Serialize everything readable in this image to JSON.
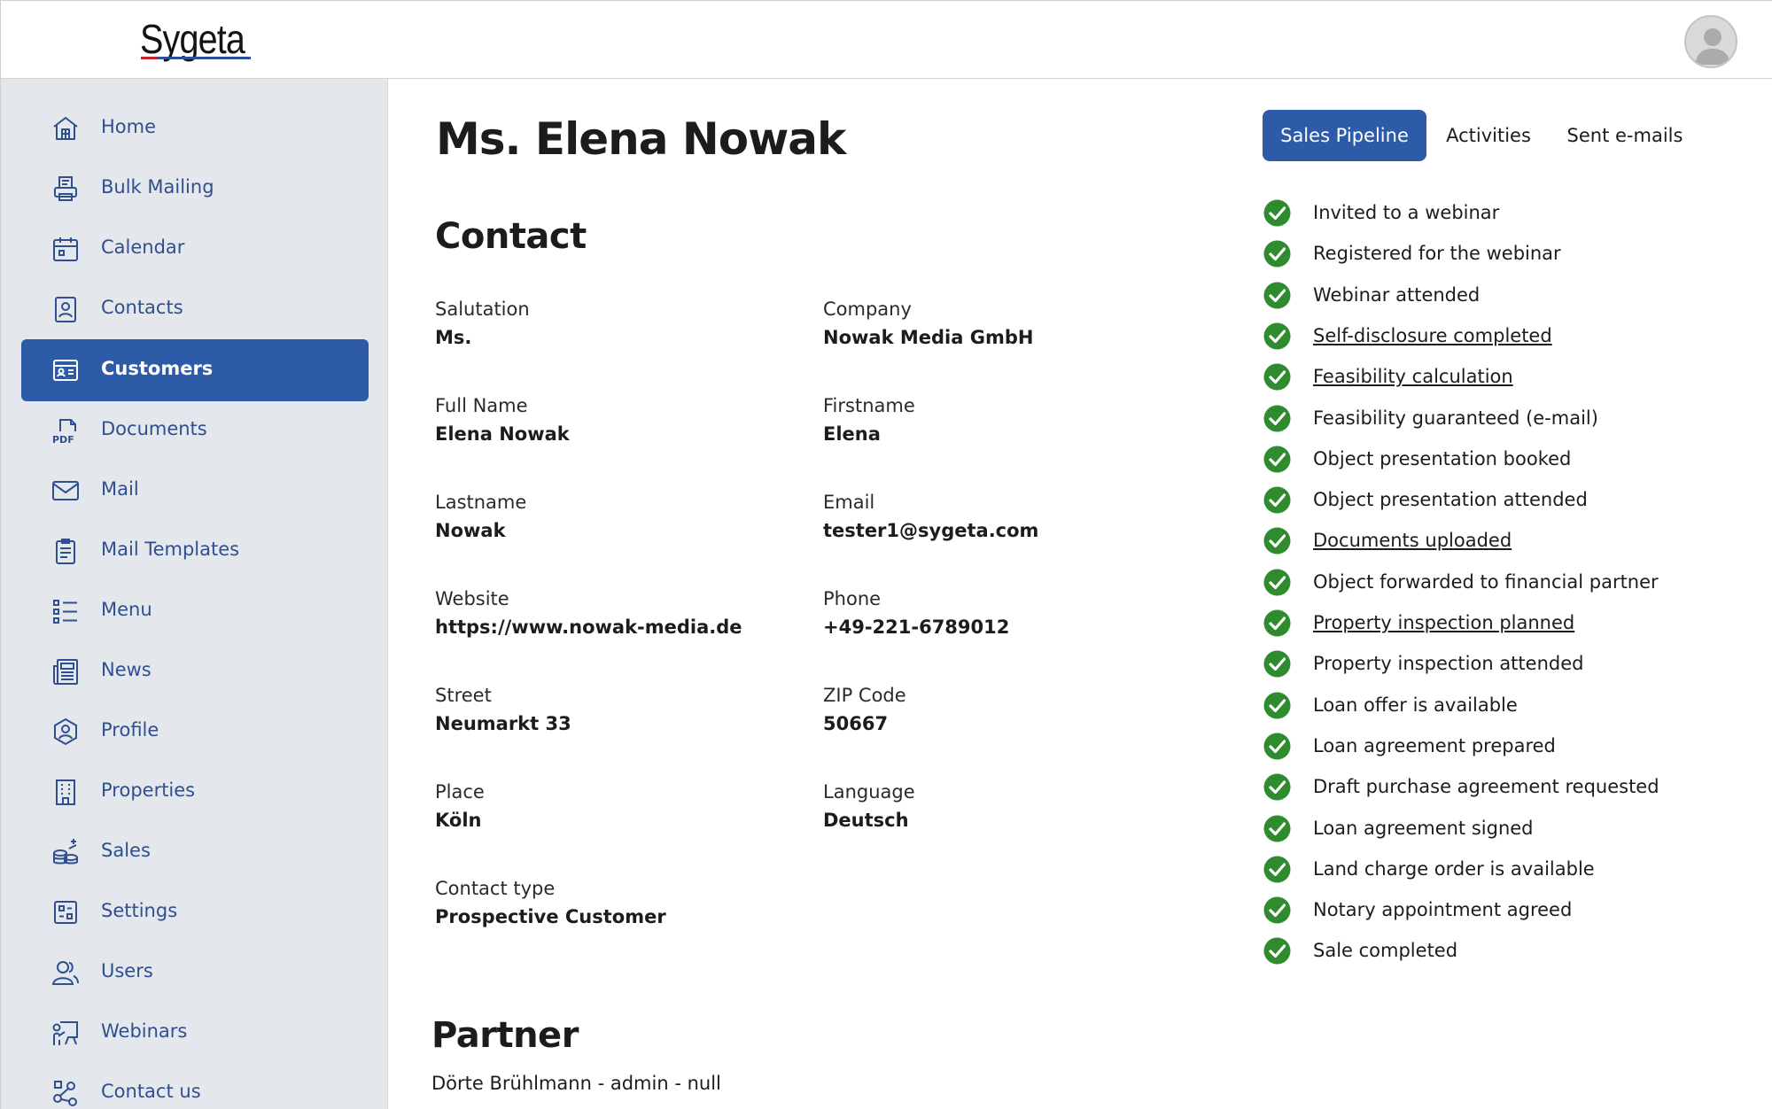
{
  "app": {
    "logo_text": "Sygeta",
    "brand_colors": {
      "primary": "#2e5ba8",
      "sidebar_bg": "#e4e7ec",
      "check_green": "#2e8b2e",
      "logo_red": "#c8232c"
    }
  },
  "header": {
    "avatar_icon": "user-avatar-icon"
  },
  "sidebar": {
    "items": [
      {
        "label": "Home",
        "icon": "home-icon",
        "active": false
      },
      {
        "label": "Bulk Mailing",
        "icon": "printer-icon",
        "active": false
      },
      {
        "label": "Calendar",
        "icon": "calendar-icon",
        "active": false
      },
      {
        "label": "Contacts",
        "icon": "contact-card-icon",
        "active": false
      },
      {
        "label": "Customers",
        "icon": "customers-icon",
        "active": true
      },
      {
        "label": "Documents",
        "icon": "pdf-icon",
        "active": false
      },
      {
        "label": "Mail",
        "icon": "envelope-icon",
        "active": false
      },
      {
        "label": "Mail Templates",
        "icon": "template-icon",
        "active": false
      },
      {
        "label": "Menu",
        "icon": "list-icon",
        "active": false
      },
      {
        "label": "News",
        "icon": "newspaper-icon",
        "active": false
      },
      {
        "label": "Profile",
        "icon": "profile-shield-icon",
        "active": false
      },
      {
        "label": "Properties",
        "icon": "building-icon",
        "active": false
      },
      {
        "label": "Sales",
        "icon": "coins-icon",
        "active": false
      },
      {
        "label": "Settings",
        "icon": "settings-icon",
        "active": false
      },
      {
        "label": "Users",
        "icon": "users-icon",
        "active": false
      },
      {
        "label": "Webinars",
        "icon": "presentation-icon",
        "active": false
      },
      {
        "label": "Contact us",
        "icon": "network-icon",
        "active": false
      }
    ]
  },
  "main": {
    "title": "Ms. Elena Nowak",
    "contact_heading": "Contact",
    "fields": [
      {
        "label": "Salutation",
        "value": "Ms."
      },
      {
        "label": "Company",
        "value": "Nowak Media GmbH"
      },
      {
        "label": "Full Name",
        "value": "Elena Nowak"
      },
      {
        "label": "Firstname",
        "value": "Elena"
      },
      {
        "label": "Lastname",
        "value": "Nowak"
      },
      {
        "label": "Email",
        "value": "tester1@sygeta.com"
      },
      {
        "label": "Website",
        "value": "https://www.nowak-media.de"
      },
      {
        "label": "Phone",
        "value": "+49-221-6789012"
      },
      {
        "label": "Street",
        "value": "Neumarkt 33"
      },
      {
        "label": "ZIP Code",
        "value": "50667"
      },
      {
        "label": "Place",
        "value": "Köln"
      },
      {
        "label": "Language",
        "value": "Deutsch"
      },
      {
        "label": "Contact type",
        "value": "Prospective Customer"
      }
    ],
    "partner_heading": "Partner",
    "partner_text": "Dörte Brühlmann - admin - null"
  },
  "tabs": [
    {
      "label": "Sales Pipeline",
      "active": true
    },
    {
      "label": "Activities",
      "active": false
    },
    {
      "label": "Sent e-mails",
      "active": false
    }
  ],
  "pipeline": [
    {
      "label": "Invited to a webinar",
      "done": true,
      "link": false
    },
    {
      "label": "Registered for the webinar",
      "done": true,
      "link": false
    },
    {
      "label": "Webinar attended",
      "done": true,
      "link": false
    },
    {
      "label": "Self-disclosure completed",
      "done": true,
      "link": true
    },
    {
      "label": "Feasibility calculation",
      "done": true,
      "link": true
    },
    {
      "label": "Feasibility guaranteed (e-mail)",
      "done": true,
      "link": false
    },
    {
      "label": "Object presentation booked",
      "done": true,
      "link": false
    },
    {
      "label": "Object presentation attended",
      "done": true,
      "link": false
    },
    {
      "label": "Documents uploaded",
      "done": true,
      "link": true
    },
    {
      "label": "Object forwarded to financial partner",
      "done": true,
      "link": false
    },
    {
      "label": "Property inspection planned",
      "done": true,
      "link": true
    },
    {
      "label": "Property inspection attended",
      "done": true,
      "link": false
    },
    {
      "label": "Loan offer is available",
      "done": true,
      "link": false
    },
    {
      "label": "Loan agreement prepared",
      "done": true,
      "link": false
    },
    {
      "label": "Draft purchase agreement requested",
      "done": true,
      "link": false
    },
    {
      "label": "Loan agreement signed",
      "done": true,
      "link": false
    },
    {
      "label": "Land charge order is available",
      "done": true,
      "link": false
    },
    {
      "label": "Notary appointment agreed",
      "done": true,
      "link": false
    },
    {
      "label": "Sale completed",
      "done": true,
      "link": false
    }
  ]
}
